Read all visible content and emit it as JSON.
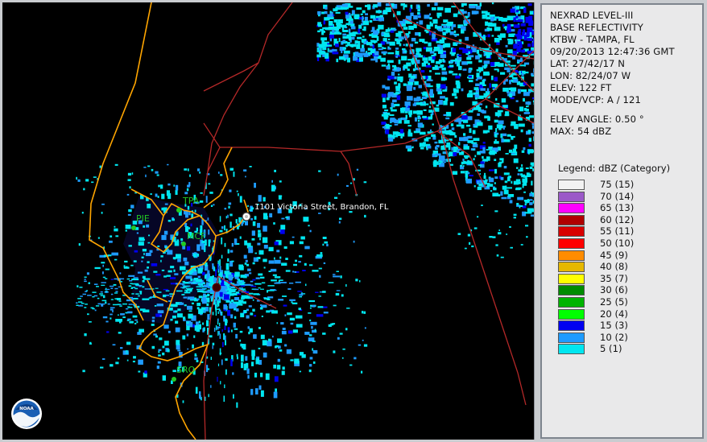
{
  "radar_info": {
    "product": "NEXRAD LEVEL-III",
    "type": "BASE REFLECTIVITY",
    "station": "KTBW - TAMPA, FL",
    "datetime": "09/20/2013 12:47:36 GMT",
    "lat": "LAT: 27/42/17 N",
    "lon": "LON: 82/24/07 W",
    "elev": "ELEV: 122 FT",
    "mode": "MODE/VCP: A / 121",
    "elev_angle": "ELEV ANGLE: 0.50 °",
    "max": "MAX: 54 dBZ"
  },
  "legend": {
    "title": "Legend: dBZ (Category)",
    "items": [
      {
        "label": "75  (15)",
        "color": "#f2f2f2"
      },
      {
        "label": "70  (14)",
        "color": "#9b59c8"
      },
      {
        "label": "65  (13)",
        "color": "#ff00ff"
      },
      {
        "label": "60  (12)",
        "color": "#b00000"
      },
      {
        "label": "55  (11)",
        "color": "#d80000"
      },
      {
        "label": "50  (10)",
        "color": "#ff0000"
      },
      {
        "label": "45  (9)",
        "color": "#ff8c00"
      },
      {
        "label": "40  (8)",
        "color": "#e6b800"
      },
      {
        "label": "35  (7)",
        "color": "#ffff00"
      },
      {
        "label": "30  (6)",
        "color": "#008c00"
      },
      {
        "label": "25  (5)",
        "color": "#00b400"
      },
      {
        "label": "20  (4)",
        "color": "#00ff00"
      },
      {
        "label": "15  (3)",
        "color": "#0000f0"
      },
      {
        "label": "10  (2)",
        "color": "#1e9bff"
      },
      {
        "label": "5  (1)",
        "color": "#00e6f0"
      }
    ]
  },
  "map": {
    "location_label": "1101 Victoria Street, Brandon, FL",
    "cities": [
      {
        "code": "TPA"
      },
      {
        "code": "PIE"
      },
      {
        "code": "MCF"
      },
      {
        "code": "SRQ"
      }
    ],
    "logo_text": "NOAA",
    "colors": {
      "coastline": "#ffa500",
      "roads": "#b42828",
      "echo_light": "#00e6f0",
      "echo_mid": "#1e9bff",
      "echo_dark": "#0000f0",
      "bay_tint": "#07072a",
      "city_label": "#22c822"
    }
  }
}
